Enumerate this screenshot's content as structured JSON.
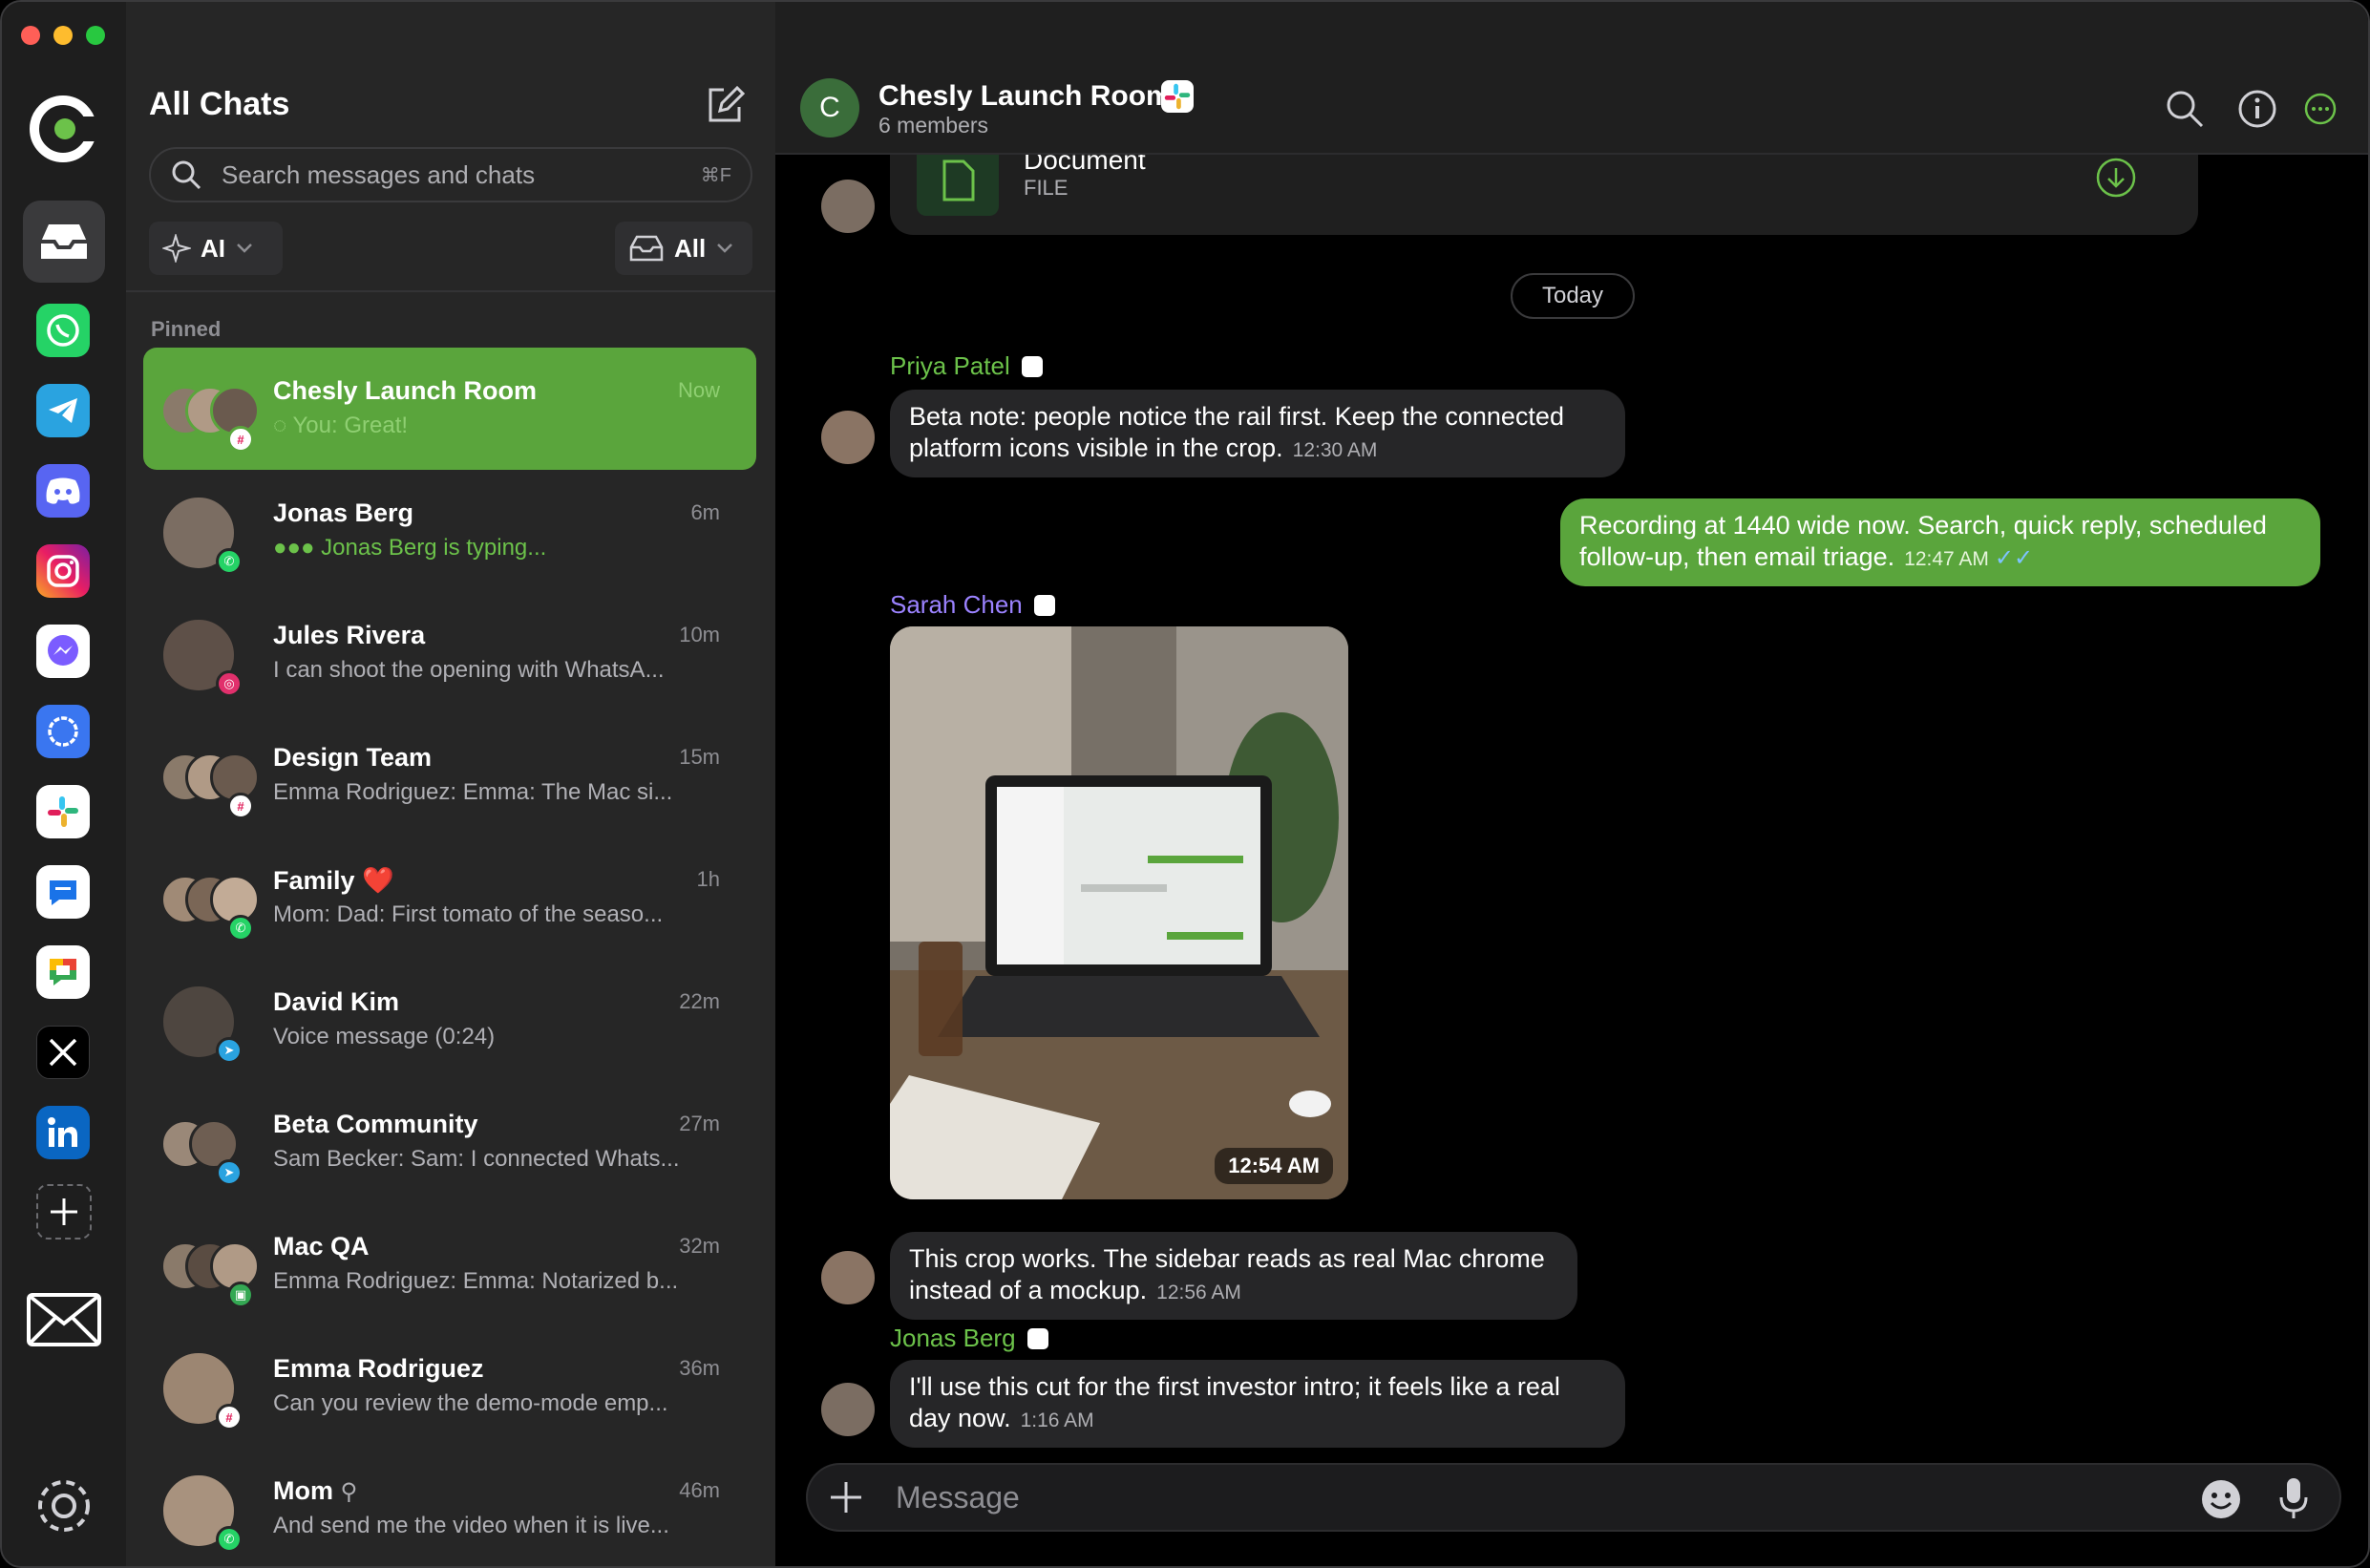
{
  "colors": {
    "accent": "#5aa53c",
    "background": "#000000",
    "sidebar": "#262626",
    "rail": "#1e1e1e"
  },
  "list": {
    "title": "All Chats",
    "search_placeholder": "Search messages and chats",
    "search_shortcut": "⌘F",
    "filter_ai": "AI",
    "filter_all": "All",
    "pinned_label": "Pinned",
    "chats": [
      {
        "name": "Chesly Launch Room",
        "time": "Now",
        "preview": "◌ You: Great!",
        "platform": "slack"
      },
      {
        "name": "Jonas Berg",
        "time": "6m",
        "preview": "●●● Jonas Berg is typing...",
        "platform": "whatsapp"
      },
      {
        "name": "Jules Rivera",
        "time": "10m",
        "preview": "I can shoot the opening with WhatsA...",
        "platform": "instagram"
      },
      {
        "name": "Design Team",
        "time": "15m",
        "preview": "Emma Rodriguez: Emma: The Mac si...",
        "platform": "slack"
      },
      {
        "name": "Family ❤️",
        "time": "1h",
        "preview": "Mom: Dad: First tomato of the seaso...",
        "platform": "whatsapp"
      },
      {
        "name": "David Kim",
        "time": "22m",
        "preview": "Voice message (0:24)",
        "platform": "telegram"
      },
      {
        "name": "Beta Community",
        "time": "27m",
        "preview": "Sam Becker: Sam: I connected Whats...",
        "platform": "telegram"
      },
      {
        "name": "Mac QA",
        "time": "32m",
        "preview": "Emma Rodriguez: Emma: Notarized b...",
        "platform": "googlechat"
      },
      {
        "name": "Emma Rodriguez",
        "time": "36m",
        "preview": "Can you review the demo-mode emp...",
        "platform": "slack"
      },
      {
        "name": "Mom",
        "time": "46m",
        "preview": "And send me the video when it is live...",
        "platform": "whatsapp"
      }
    ]
  },
  "chat": {
    "avatar_letter": "C",
    "title": "Chesly Launch Room",
    "members": "6 members",
    "doc_name": "Document",
    "doc_type": "FILE",
    "today": "Today",
    "messages": [
      {
        "sender": "Priya Patel",
        "text": "Beta note: people notice the rail first. Keep the connected platform icons visible in the crop.",
        "time": "12:30 AM"
      },
      {
        "sender": "",
        "text": "Recording at 1440 wide now. Search, quick reply, scheduled follow-up, then email triage.",
        "time": "12:47 AM",
        "ticks": "✓✓"
      },
      {
        "sender": "Sarah Chen",
        "photo_time": "12:54 AM"
      },
      {
        "sender": "",
        "text": "This crop works. The sidebar reads as real Mac chrome instead of a mockup.",
        "time": "12:56 AM"
      },
      {
        "sender": "Jonas Berg",
        "text": "I'll use this cut for the first investor intro; it feels like a real day now.",
        "time": "1:16 AM"
      }
    ],
    "composer_placeholder": "Message"
  }
}
